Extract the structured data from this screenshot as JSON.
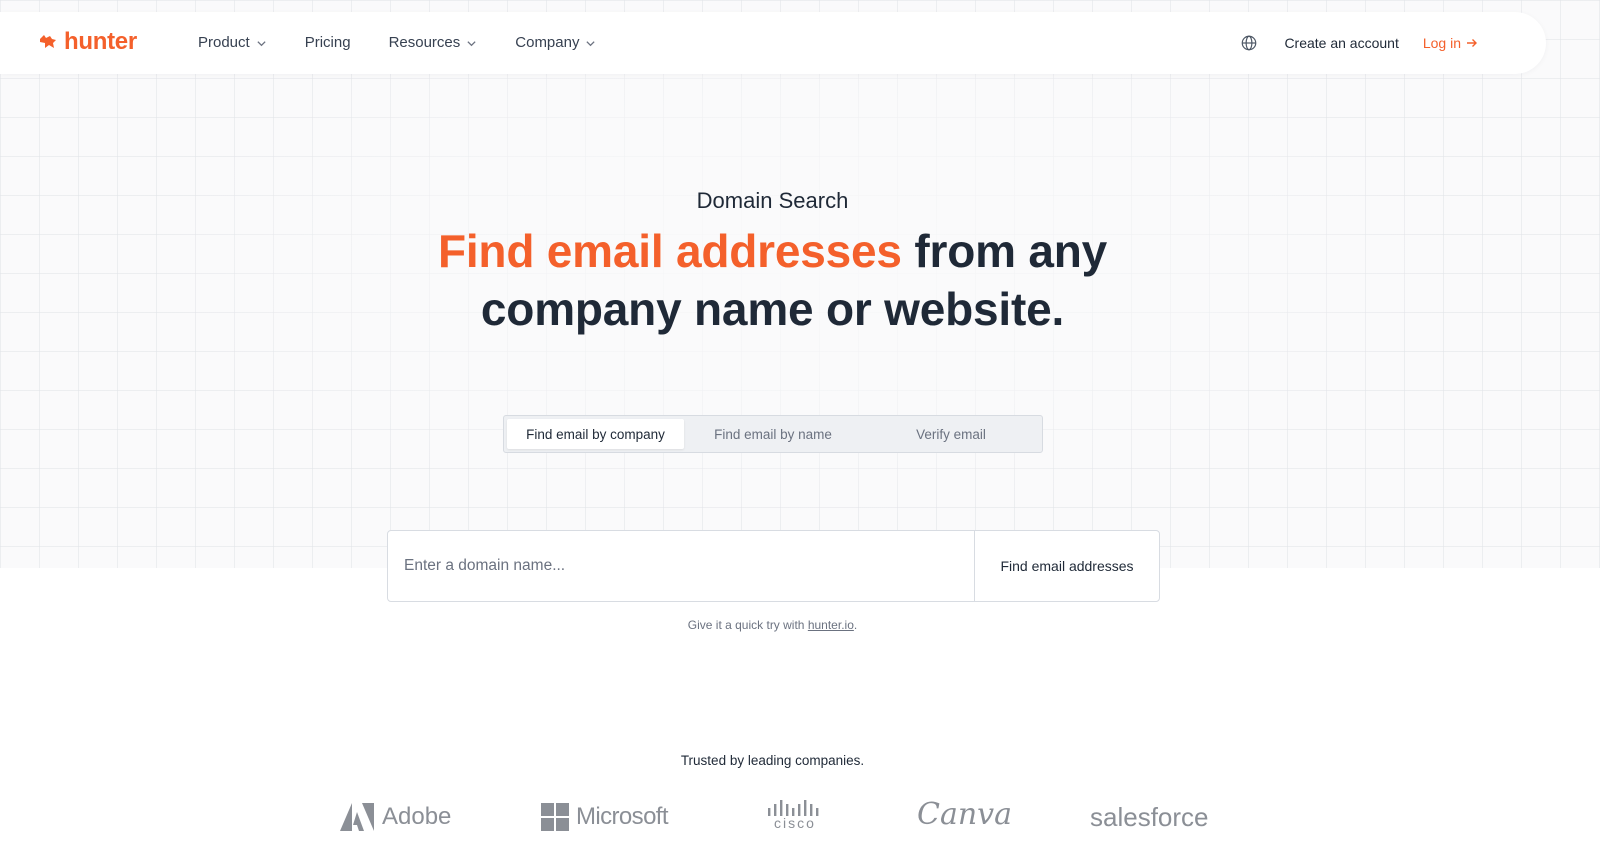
{
  "brand": {
    "name": "hunter",
    "accent_color": "#f4602b"
  },
  "nav": {
    "items": [
      {
        "label": "Product",
        "has_dropdown": true
      },
      {
        "label": "Pricing",
        "has_dropdown": false
      },
      {
        "label": "Resources",
        "has_dropdown": true
      },
      {
        "label": "Company",
        "has_dropdown": true
      }
    ],
    "language_icon": "globe-icon",
    "create_account": "Create an account",
    "login": "Log in",
    "login_icon": "arrow-right-icon"
  },
  "hero": {
    "eyebrow": "Domain Search",
    "headline_accent": "Find email addresses",
    "headline_rest_line1": " from any",
    "headline_line2": "company name or website."
  },
  "tabs": [
    {
      "label": "Find email by company",
      "active": true
    },
    {
      "label": "Find email by name",
      "active": false
    },
    {
      "label": "Verify email",
      "active": false
    }
  ],
  "search": {
    "placeholder": "Enter a domain name...",
    "value": "",
    "button": "Find email addresses"
  },
  "hint": {
    "prefix": "Give it a quick try with ",
    "link": "hunter.io",
    "suffix": "."
  },
  "trusted": {
    "heading": "Trusted by leading companies.",
    "logos": [
      "Adobe",
      "Microsoft",
      "cisco",
      "Canva",
      "salesforce"
    ],
    "logo_color": "#8b8f96"
  }
}
